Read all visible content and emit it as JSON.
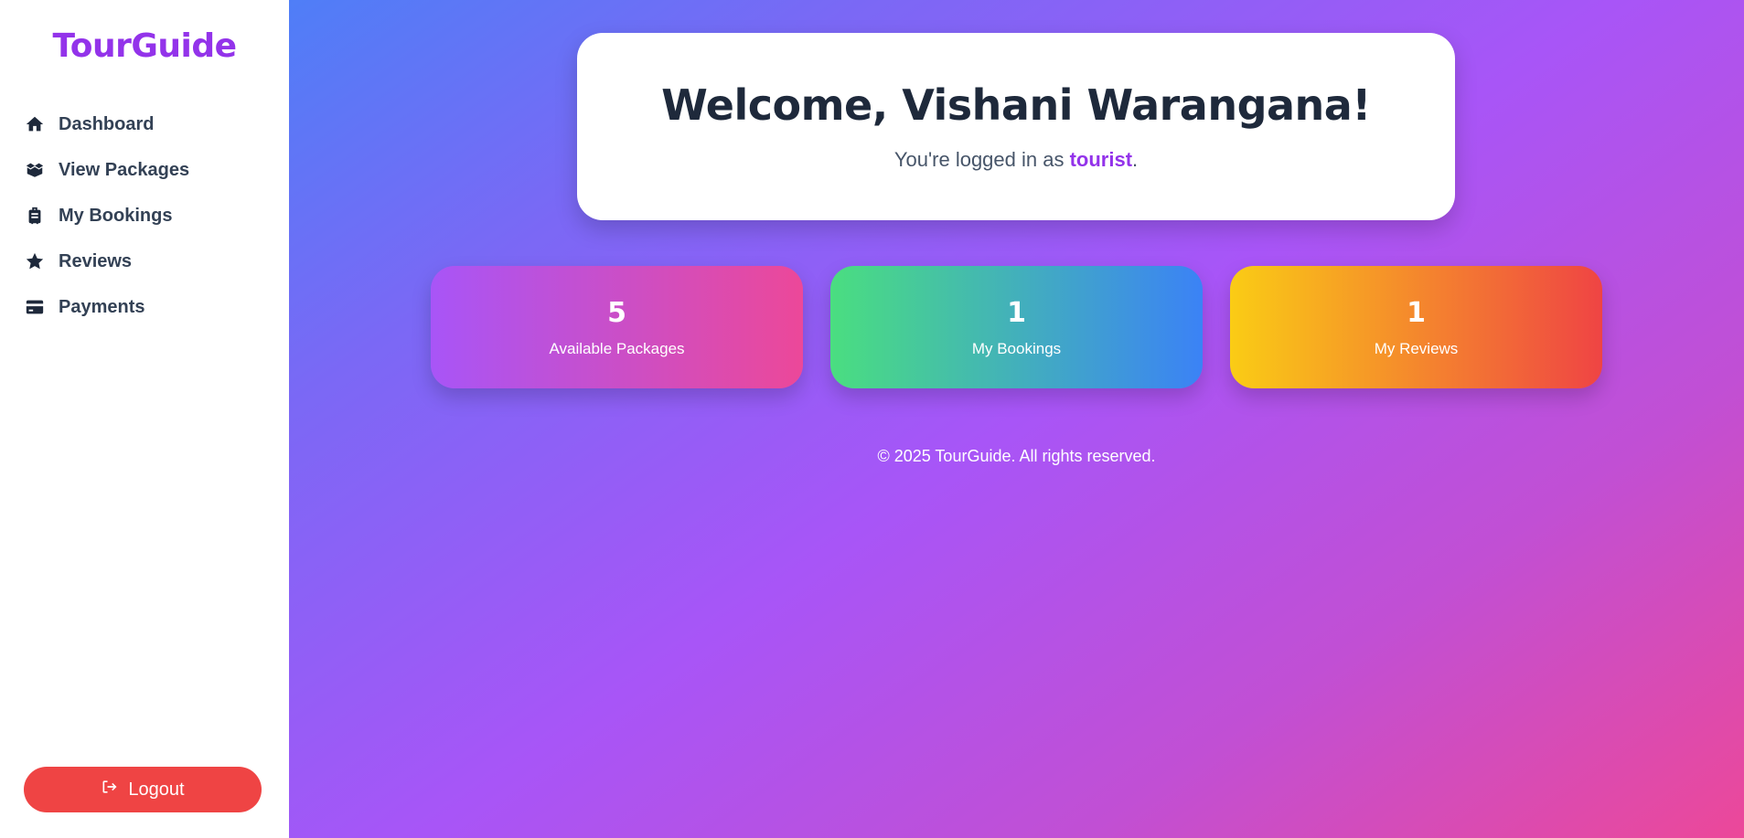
{
  "app": {
    "brand": "TourGuide"
  },
  "sidebar": {
    "items": [
      {
        "label": "Dashboard",
        "icon": "home-icon"
      },
      {
        "label": "View Packages",
        "icon": "box-open-icon"
      },
      {
        "label": "My Bookings",
        "icon": "suitcase-icon"
      },
      {
        "label": "Reviews",
        "icon": "star-icon"
      },
      {
        "label": "Payments",
        "icon": "credit-card-icon"
      }
    ],
    "logout_label": "Logout"
  },
  "welcome": {
    "title": "Welcome, Vishani Warangana!",
    "subtitle_prefix": "You're logged in as ",
    "role": "tourist",
    "subtitle_suffix": "."
  },
  "stats": [
    {
      "value": "5",
      "label": "Available Packages",
      "gradient": [
        "#a855f7",
        "#ec4899"
      ]
    },
    {
      "value": "1",
      "label": "My Bookings",
      "gradient": [
        "#4ade80",
        "#3b82f6"
      ]
    },
    {
      "value": "1",
      "label": "My Reviews",
      "gradient": [
        "#facc15",
        "#ef4444"
      ]
    }
  ],
  "footer": {
    "text": "© 2025 TourGuide. All rights reserved."
  },
  "colors": {
    "brand": "#9333ea",
    "logout": "#ef4444",
    "text_dark": "#1e293b"
  }
}
